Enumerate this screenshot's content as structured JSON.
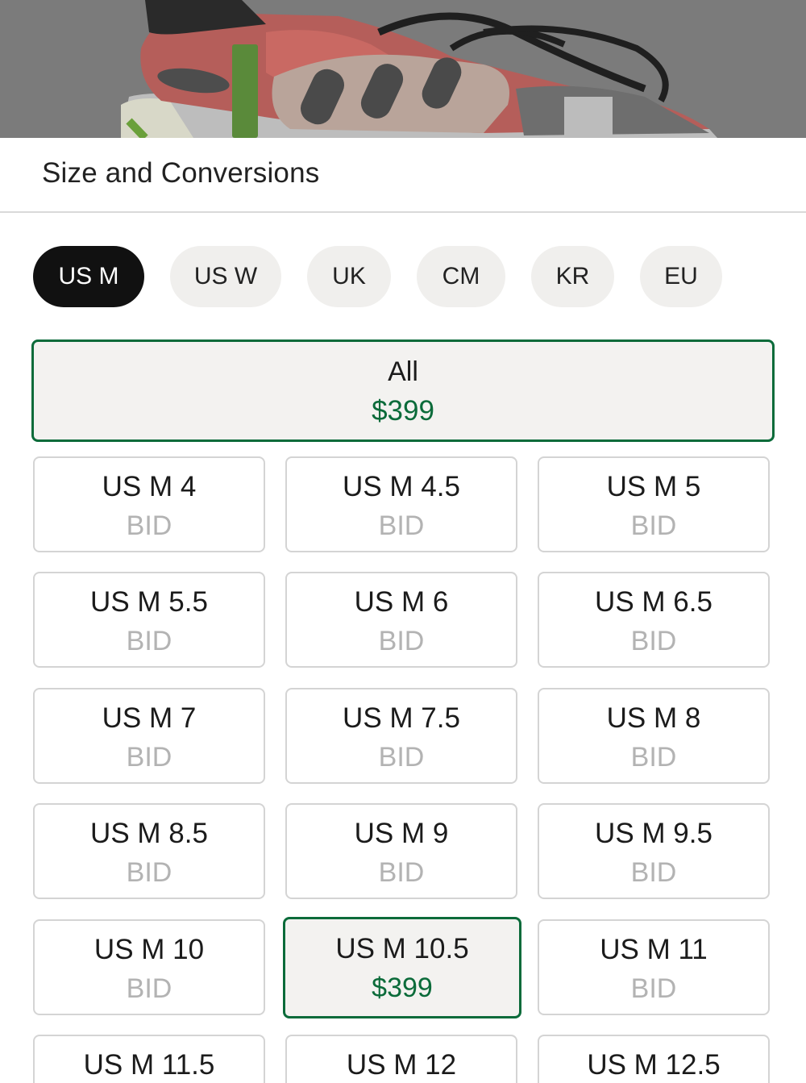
{
  "header": {
    "title": "Size and Conversions"
  },
  "size_systems": [
    {
      "label": "US M",
      "active": true
    },
    {
      "label": "US W",
      "active": false
    },
    {
      "label": "UK",
      "active": false
    },
    {
      "label": "CM",
      "active": false
    },
    {
      "label": "KR",
      "active": false
    },
    {
      "label": "EU",
      "active": false
    }
  ],
  "all_option": {
    "label": "All",
    "price": "$399"
  },
  "sizes": [
    {
      "label": "US M 4",
      "price": "BID",
      "selected": false
    },
    {
      "label": "US M 4.5",
      "price": "BID",
      "selected": false
    },
    {
      "label": "US M 5",
      "price": "BID",
      "selected": false
    },
    {
      "label": "US M 5.5",
      "price": "BID",
      "selected": false
    },
    {
      "label": "US M 6",
      "price": "BID",
      "selected": false
    },
    {
      "label": "US M 6.5",
      "price": "BID",
      "selected": false
    },
    {
      "label": "US M 7",
      "price": "BID",
      "selected": false
    },
    {
      "label": "US M 7.5",
      "price": "BID",
      "selected": false
    },
    {
      "label": "US M 8",
      "price": "BID",
      "selected": false
    },
    {
      "label": "US M 8.5",
      "price": "BID",
      "selected": false
    },
    {
      "label": "US M 9",
      "price": "BID",
      "selected": false
    },
    {
      "label": "US M 9.5",
      "price": "BID",
      "selected": false
    },
    {
      "label": "US M 10",
      "price": "BID",
      "selected": false
    },
    {
      "label": "US M 10.5",
      "price": "$399",
      "selected": true
    },
    {
      "label": "US M 11",
      "price": "BID",
      "selected": false
    },
    {
      "label": "US M 11.5",
      "price": "",
      "selected": false
    },
    {
      "label": "US M 12",
      "price": "",
      "selected": false
    },
    {
      "label": "US M 12.5",
      "price": "",
      "selected": false
    }
  ],
  "colors": {
    "accent": "#0b6b3a",
    "chip_active": "#111111",
    "chip": "#f0efed",
    "muted": "#b3b3b3"
  }
}
